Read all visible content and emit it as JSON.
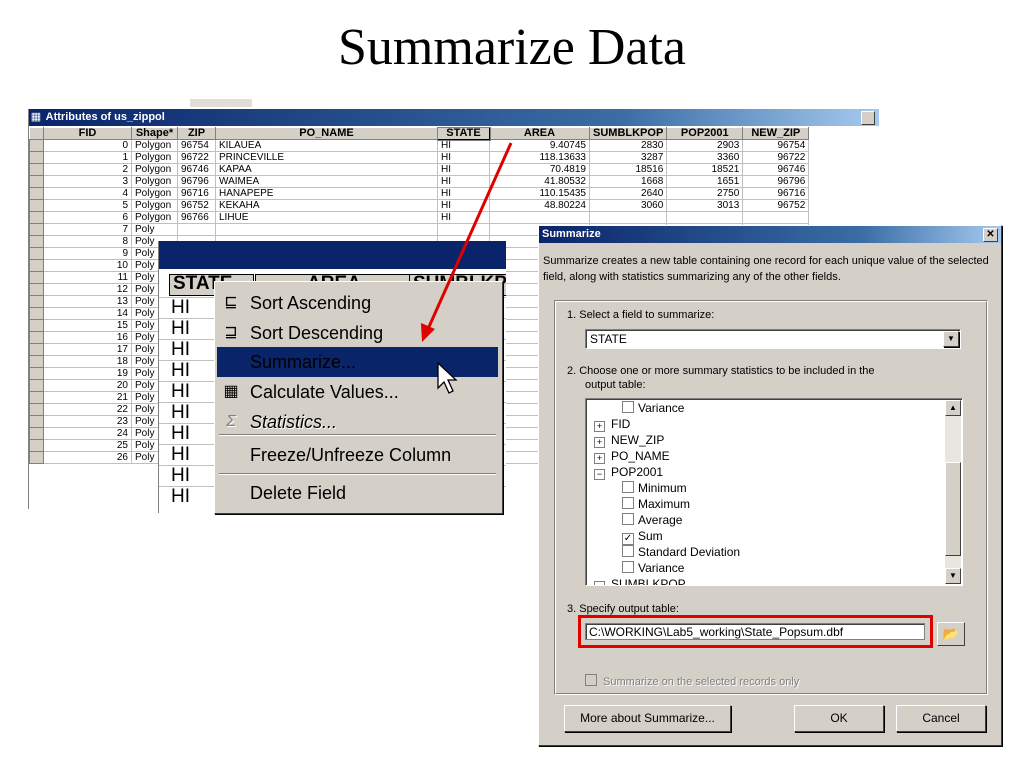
{
  "slide": {
    "title": "Summarize Data"
  },
  "attributes_window": {
    "title": "Attributes of us_zippol",
    "title_icon": "table-grid-icon",
    "columns": [
      "FID",
      "Shape*",
      "ZIP",
      "PO_NAME",
      "STATE",
      "AREA",
      "SUMBLKPOP",
      "POP2001",
      "NEW_ZIP"
    ],
    "rows": [
      [
        "0",
        "Polygon",
        "96754",
        "KILAUEA",
        "HI",
        "9.40745",
        "2830",
        "2903",
        "96754"
      ],
      [
        "1",
        "Polygon",
        "96722",
        "PRINCEVILLE",
        "HI",
        "118.13633",
        "3287",
        "3360",
        "96722"
      ],
      [
        "2",
        "Polygon",
        "96746",
        "KAPAA",
        "HI",
        "70.4819",
        "18516",
        "18521",
        "96746"
      ],
      [
        "3",
        "Polygon",
        "96796",
        "WAIMEA",
        "HI",
        "41.80532",
        "1668",
        "1651",
        "96796"
      ],
      [
        "4",
        "Polygon",
        "96716",
        "HANAPEPE",
        "HI",
        "110.15435",
        "2640",
        "2750",
        "96716"
      ],
      [
        "5",
        "Polygon",
        "96752",
        "KEKAHA",
        "HI",
        "48.80224",
        "3060",
        "3013",
        "96752"
      ],
      [
        "6",
        "Polygon",
        "96766",
        "LIHUE",
        "HI",
        "",
        "",
        "",
        ""
      ],
      [
        "7",
        "Poly",
        "",
        "",
        "",
        "",
        "",
        "",
        ""
      ],
      [
        "8",
        "Poly",
        "",
        "",
        "",
        "",
        "",
        "",
        ""
      ],
      [
        "9",
        "Poly",
        "",
        "",
        "",
        "",
        "",
        "",
        ""
      ],
      [
        "10",
        "Poly",
        "",
        "",
        "",
        "",
        "",
        "",
        ""
      ],
      [
        "11",
        "Poly",
        "",
        "",
        "",
        "",
        "",
        "",
        ""
      ],
      [
        "12",
        "Poly",
        "",
        "",
        "",
        "",
        "",
        "",
        ""
      ],
      [
        "13",
        "Poly",
        "",
        "",
        "",
        "",
        "",
        "",
        ""
      ],
      [
        "14",
        "Poly",
        "",
        "",
        "",
        "",
        "",
        "",
        ""
      ],
      [
        "15",
        "Poly",
        "",
        "",
        "",
        "",
        "",
        "",
        ""
      ],
      [
        "16",
        "Poly",
        "",
        "",
        "",
        "",
        "",
        "",
        ""
      ],
      [
        "17",
        "Poly",
        "",
        "",
        "",
        "",
        "",
        "",
        ""
      ],
      [
        "18",
        "Poly",
        "",
        "",
        "",
        "",
        "",
        "",
        ""
      ],
      [
        "19",
        "Poly",
        "",
        "",
        "",
        "",
        "",
        "",
        ""
      ],
      [
        "20",
        "Poly",
        "",
        "",
        "",
        "",
        "",
        "",
        ""
      ],
      [
        "21",
        "Poly",
        "",
        "",
        "",
        "",
        "",
        "",
        ""
      ],
      [
        "22",
        "Poly",
        "",
        "",
        "",
        "",
        "",
        "",
        ""
      ],
      [
        "23",
        "Poly",
        "",
        "",
        "",
        "",
        "",
        "",
        ""
      ],
      [
        "24",
        "Poly",
        "",
        "",
        "",
        "",
        "",
        "",
        ""
      ],
      [
        "25",
        "Poly",
        "",
        "",
        "",
        "",
        "",
        "",
        ""
      ],
      [
        "26",
        "Poly",
        "",
        "",
        "",
        "",
        "",
        "",
        ""
      ]
    ]
  },
  "zoom_overlay": {
    "headers": [
      "STATE",
      "AREA",
      "SUMBLKPOP"
    ],
    "state_values": [
      "HI",
      "HI",
      "HI",
      "HI",
      "HI",
      "HI",
      "HI",
      "HI",
      "HI",
      "HI"
    ]
  },
  "context_menu": {
    "items": [
      {
        "label": "Sort Ascending",
        "icon": "sort-ascending-icon",
        "glyph": "⊑"
      },
      {
        "label": "Sort Descending",
        "icon": "sort-descending-icon",
        "glyph": "⊒"
      },
      {
        "label": "Summarize...",
        "icon": "",
        "glyph": "",
        "selected": true
      },
      {
        "label": "Calculate Values...",
        "icon": "calculator-icon",
        "glyph": "▦"
      },
      {
        "label": "Statistics...",
        "icon": "sigma-icon",
        "glyph": "Σ",
        "disabled": true
      },
      {
        "label": "Freeze/Unfreeze Column",
        "icon": "",
        "glyph": ""
      },
      {
        "label": "Delete Field",
        "icon": "",
        "glyph": ""
      }
    ]
  },
  "summarize_dialog": {
    "title": "Summarize",
    "description": "Summarize creates a new table containing one record for each unique value of the selected field, along with statistics summarizing any of the other fields.",
    "step1_label": "1.  Select a field to summarize:",
    "field_value": "STATE",
    "step2_label_line1": "2.  Choose one or more summary statistics to be included in the",
    "step2_label_line2": "output table:",
    "tree": [
      {
        "text": "Variance",
        "level": 2,
        "type": "check",
        "checked": false
      },
      {
        "text": "FID",
        "level": 1,
        "type": "node",
        "expanded": false
      },
      {
        "text": "NEW_ZIP",
        "level": 1,
        "type": "node",
        "expanded": false
      },
      {
        "text": "PO_NAME",
        "level": 1,
        "type": "node",
        "expanded": false
      },
      {
        "text": "POP2001",
        "level": 1,
        "type": "node",
        "expanded": true
      },
      {
        "text": "Minimum",
        "level": 2,
        "type": "check",
        "checked": false
      },
      {
        "text": "Maximum",
        "level": 2,
        "type": "check",
        "checked": false
      },
      {
        "text": "Average",
        "level": 2,
        "type": "check",
        "checked": false
      },
      {
        "text": "Sum",
        "level": 2,
        "type": "check",
        "checked": true
      },
      {
        "text": "Standard Deviation",
        "level": 2,
        "type": "check",
        "checked": false
      },
      {
        "text": "Variance",
        "level": 2,
        "type": "check",
        "checked": false
      },
      {
        "text": "SUMBLKPOP",
        "level": 1,
        "type": "node",
        "expanded": true
      }
    ],
    "step3_label": "3.  Specify output table:",
    "output_path": "C:\\WORKING\\Lab5_working\\State_Popsum.dbf",
    "selected_only_label": "Summarize on the selected records only",
    "more_button": "More about Summarize...",
    "ok_button": "OK",
    "cancel_button": "Cancel"
  },
  "colors": {
    "titlebar": "#0a246a",
    "highlight_box": "#e00000",
    "arrow": "#e00000"
  }
}
